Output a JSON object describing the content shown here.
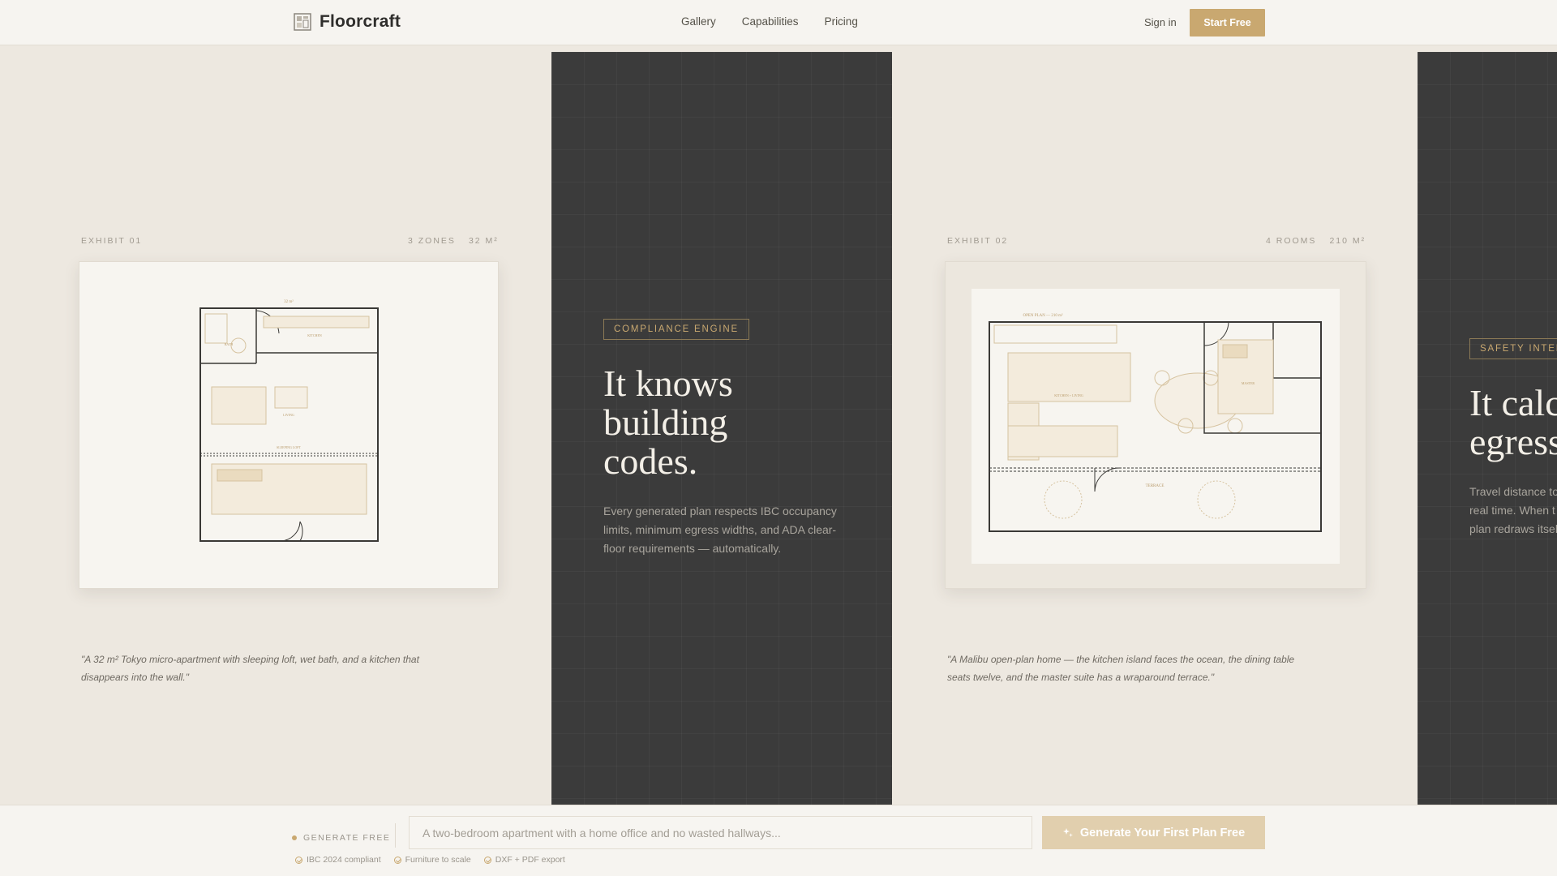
{
  "header": {
    "brand": "Floorcraft",
    "nav": [
      "Gallery",
      "Capabilities",
      "Pricing"
    ],
    "sign_in": "Sign in",
    "start_free": "Start Free"
  },
  "exhibits": [
    {
      "label": "EXHIBIT 01",
      "stat1": "3 ZONES",
      "stat2": "32 M²",
      "caption_line1": "\"A 32 m² Tokyo micro-apartment with sleeping loft, wet bath, and a kitchen that",
      "caption_line2": "disappears into the wall.\"",
      "plan_labels": {
        "area": "32 m²",
        "kitchen": "KITCHEN",
        "bath": "BATH",
        "living": "LIVING",
        "loft": "SLEEPING LOFT"
      }
    },
    {
      "label": "EXHIBIT 02",
      "stat1": "4 ROOMS",
      "stat2": "210 M²",
      "caption_line1": "\"A Malibu open-plan home — the kitchen island faces the ocean, the dining table",
      "caption_line2": "seats twelve, and the master suite has a wraparound terrace.\"",
      "plan_labels": {
        "area": "OPEN PLAN — 210 m²",
        "kitchen": "KITCHEN + LIVING",
        "master": "MASTER",
        "terrace": "TERRACE"
      }
    }
  ],
  "features_panels": [
    {
      "tag": "COMPLIANCE ENGINE",
      "title_lines": [
        "It knows",
        "building",
        "codes."
      ],
      "body_lines": [
        "Every generated plan respects IBC occupancy",
        "limits, minimum egress widths, and ADA clear-",
        "floor requirements — automatically."
      ]
    },
    {
      "tag": "SAFETY INTEL",
      "title_lines": [
        "It calc",
        "egress"
      ],
      "body_lines": [
        "Travel distance to",
        "real time. When t",
        "plan redraws itsel"
      ]
    }
  ],
  "bottom_bar": {
    "label": "GENERATE FREE",
    "input_placeholder": "A two-bedroom apartment with a home office and no wasted hallways...",
    "button": "Generate Your First Plan Free",
    "features": [
      "IBC 2024 compliant",
      "Furniture to scale",
      "DXF + PDF export"
    ]
  },
  "colors": {
    "accent": "#c9a870",
    "dark_panel": "#3b3b3b",
    "background": "#ede8e0"
  }
}
